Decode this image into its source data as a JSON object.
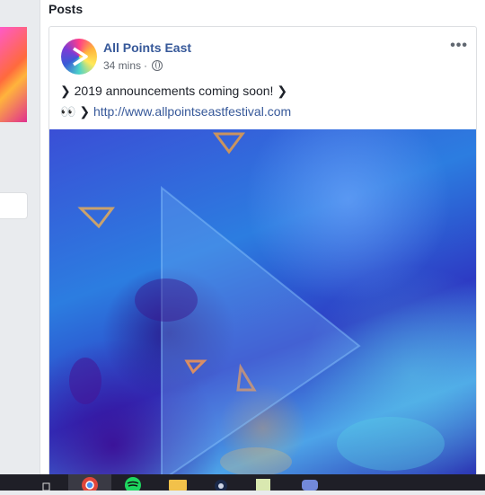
{
  "section": {
    "title": "Posts"
  },
  "post": {
    "author": "All Points East",
    "time": "34 mins",
    "separator": "·",
    "text": "❯ 2019 announcements coming soon! ❯",
    "line2_prefix": "👀 ❯ ",
    "link": "http://www.allpointseastfestival.com",
    "more": "•••"
  },
  "icons": {
    "avatar": "all-points-east-logo",
    "privacy": "globe-icon",
    "options": "more-options-icon"
  },
  "taskbar": {
    "items": [
      "windows-start-icon",
      "chrome-icon",
      "spotify-icon",
      "file-explorer-icon",
      "steam-icon",
      "app-icon",
      "discord-icon"
    ]
  },
  "colors": {
    "link": "#365899",
    "accent_blue": "#2c7de0"
  }
}
